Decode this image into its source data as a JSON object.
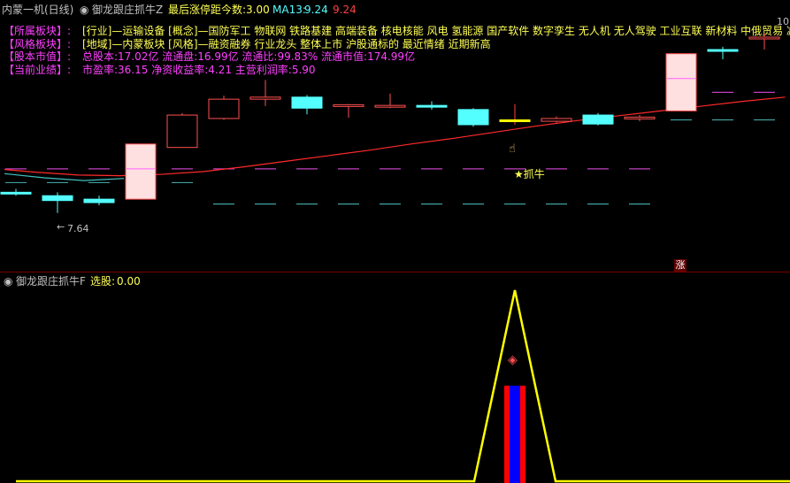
{
  "top_panel": {
    "collapse_icon": "chevron-down-icon",
    "stock_title": "内蒙一机(日线)",
    "indicator_name": "御龙跟庄抓牛Z",
    "limit_up_label": "最后涨停距今数:",
    "limit_up_value": "3.00",
    "ma_label": "MA13:",
    "ma_value": "9.24",
    "last_value": "9.24",
    "right_marker": "10",
    "info_lines": [
      {
        "label": "【所属板块】:",
        "text": "[行业]—运输设备 [概念]—国防军工 物联网 铁路基建 高端装备 核电核能 风电 氢能源 国产软件 数字孪生 无人机 无人驾驶 工业互联 新材料 中俄贸易 减速"
      },
      {
        "label": "【风格板块】:",
        "text": "[地域]—内蒙板块 [风格]—融资融券 行业龙头 整体上市 沪股通标的 最近情绪 近期新高"
      },
      {
        "label": "【股本市值】:",
        "text": "总股本:17.02亿 流通盘:16.99亿 流通比:99.83% 流通市值:174.99亿"
      },
      {
        "label": "【当前业绩】:",
        "text": "市盈率:36.15 净资收益率:4.21 主营利润率:5.90"
      }
    ],
    "low_price_label": "7.64",
    "signal_label": "★抓牛",
    "rise_badge": "涨",
    "colors": {
      "up": "#ff5050",
      "down": "#54ffff",
      "signal": "#ffff00",
      "ma_line": "#ff2a2a",
      "info_label": "#ff40ff",
      "info_text": "#ffff55",
      "value_red": "#ff4040"
    }
  },
  "bottom_panel": {
    "collapse_icon": "chevron-down-icon",
    "indicator_name": "御龙跟庄抓牛F",
    "select_label": "选股:",
    "select_value": "0.00",
    "gem_icon": "diamond-icon",
    "colors": {
      "triangle": "#ffff00",
      "bar_outer": "#ff0000",
      "bar_inner": "#0000ff"
    }
  },
  "chart_data": {
    "type": "candlestick",
    "price_range": [
      7.4,
      10.3
    ],
    "candles": [
      {
        "open": 8.05,
        "high": 8.1,
        "low": 8.0,
        "close": 8.03,
        "dir": "down"
      },
      {
        "open": 8.0,
        "high": 8.05,
        "low": 7.75,
        "close": 7.93,
        "dir": "down"
      },
      {
        "open": 7.9,
        "high": 8.0,
        "low": 7.86,
        "close": 7.95,
        "dir": "down"
      },
      {
        "open": 7.95,
        "high": 8.75,
        "low": 7.95,
        "close": 8.75,
        "dir": "up"
      },
      {
        "open": 8.7,
        "high": 9.2,
        "low": 8.7,
        "close": 9.17,
        "dir": "up"
      },
      {
        "open": 9.12,
        "high": 9.45,
        "low": 9.1,
        "close": 9.4,
        "dir": "up"
      },
      {
        "open": 9.4,
        "high": 9.68,
        "low": 9.3,
        "close": 9.43,
        "dir": "up"
      },
      {
        "open": 9.43,
        "high": 9.46,
        "low": 9.18,
        "close": 9.27,
        "dir": "down"
      },
      {
        "open": 9.3,
        "high": 9.33,
        "low": 9.13,
        "close": 9.32,
        "dir": "up"
      },
      {
        "open": 9.3,
        "high": 9.48,
        "low": 9.27,
        "close": 9.31,
        "dir": "up"
      },
      {
        "open": 9.3,
        "high": 9.37,
        "low": 9.25,
        "close": 9.31,
        "dir": "down"
      },
      {
        "open": 9.25,
        "high": 9.27,
        "low": 9.0,
        "close": 9.03,
        "dir": "down"
      },
      {
        "open": 9.1,
        "high": 9.33,
        "low": 9.03,
        "close": 9.09,
        "dir": "signal"
      },
      {
        "open": 9.08,
        "high": 9.15,
        "low": 9.06,
        "close": 9.12,
        "dir": "up"
      },
      {
        "open": 9.17,
        "high": 9.2,
        "low": 9.02,
        "close": 9.04,
        "dir": "down"
      },
      {
        "open": 9.12,
        "high": 9.17,
        "low": 9.08,
        "close": 9.14,
        "dir": "up"
      },
      {
        "open": 9.23,
        "high": 10.06,
        "low": 9.23,
        "close": 10.06,
        "dir": "up"
      },
      {
        "open": 10.12,
        "high": 10.16,
        "low": 9.98,
        "close": 10.12,
        "dir": "down"
      },
      {
        "open": 10.3,
        "high": 10.35,
        "low": 10.12,
        "close": 10.3,
        "dir": "up"
      }
    ],
    "ma13": [
      8.38,
      8.34,
      8.3,
      8.29,
      8.31,
      8.35,
      8.42,
      8.5,
      8.58,
      8.66,
      8.75,
      8.83,
      8.92,
      9.01,
      9.09,
      9.16,
      9.23,
      9.3,
      9.37,
      9.43
    ],
    "band_upper": 8.39,
    "band_lower": 8.19,
    "band_mid": 8.39,
    "band_mid_lower": 7.88
  }
}
